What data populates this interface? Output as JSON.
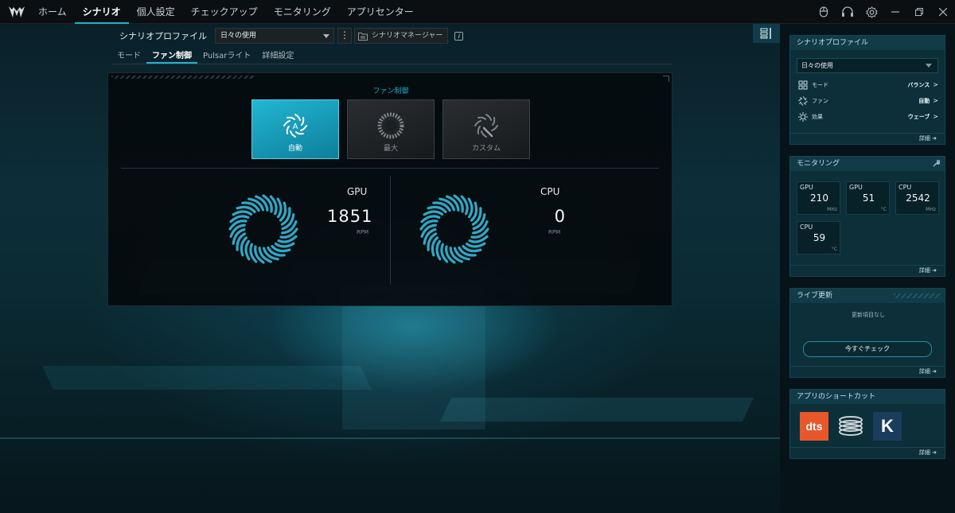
{
  "topbar": {
    "tabs": [
      {
        "label": "ホーム"
      },
      {
        "label": "シナリオ"
      },
      {
        "label": "個人設定"
      },
      {
        "label": "チェックアップ"
      },
      {
        "label": "モニタリング"
      },
      {
        "label": "アプリセンター"
      }
    ],
    "active_tab": "シナリオ",
    "icons": [
      "mouse-icon",
      "headset-icon",
      "gear-icon",
      "minimize-icon",
      "restore-icon",
      "close-icon"
    ]
  },
  "profile": {
    "label": "シナリオプロファイル",
    "selected": "日々の使用",
    "manager_label": "シナリオマネージャー"
  },
  "subtabs": [
    {
      "label": "モード"
    },
    {
      "label": "ファン制御"
    },
    {
      "label": "Pulsarライト"
    },
    {
      "label": "詳細設定"
    }
  ],
  "fan_control": {
    "title": "ファン制御",
    "modes": [
      {
        "label": "自動",
        "active": true
      },
      {
        "label": "最大",
        "active": false
      },
      {
        "label": "カスタム",
        "active": false
      }
    ],
    "gauges": [
      {
        "name": "GPU",
        "rpm": "1851",
        "unit": "RPM"
      },
      {
        "name": "CPU",
        "rpm": "0",
        "unit": "RPM"
      }
    ]
  },
  "sidebar": {
    "profile_card": {
      "title": "シナリオプロファイル",
      "selected": "日々の使用",
      "rows": [
        {
          "label": "モード",
          "value": "バランス",
          "icon": "grid-icon"
        },
        {
          "label": "ファン",
          "value": "自動",
          "icon": "fan-icon"
        },
        {
          "label": "効果",
          "value": "ウェーブ",
          "icon": "sun-icon"
        }
      ],
      "detail": "詳細"
    },
    "monitor_card": {
      "title": "モニタリング",
      "tiles": [
        {
          "label": "GPU",
          "value": "210",
          "unit": "MHz"
        },
        {
          "label": "GPU",
          "value": "51",
          "unit": "°C"
        },
        {
          "label": "CPU",
          "value": "2542",
          "unit": "MHz"
        },
        {
          "label": "CPU",
          "value": "59",
          "unit": "°C"
        }
      ],
      "detail": "詳細"
    },
    "live_card": {
      "title": "ライブ更新",
      "empty_text": "更新項目なし",
      "check_label": "今すぐチェック",
      "detail": "詳細"
    },
    "shortcut_card": {
      "title": "アプリのショートカット",
      "apps": [
        {
          "label": "dts"
        },
        {
          "icon": "coil-icon"
        },
        {
          "label": "K"
        }
      ],
      "detail": "詳細"
    }
  },
  "colors": {
    "accent": "#1fb3cc",
    "sidebar_card": "#0c2f3a",
    "dts": "#e8572a",
    "k_app": "#1a3d5e"
  }
}
